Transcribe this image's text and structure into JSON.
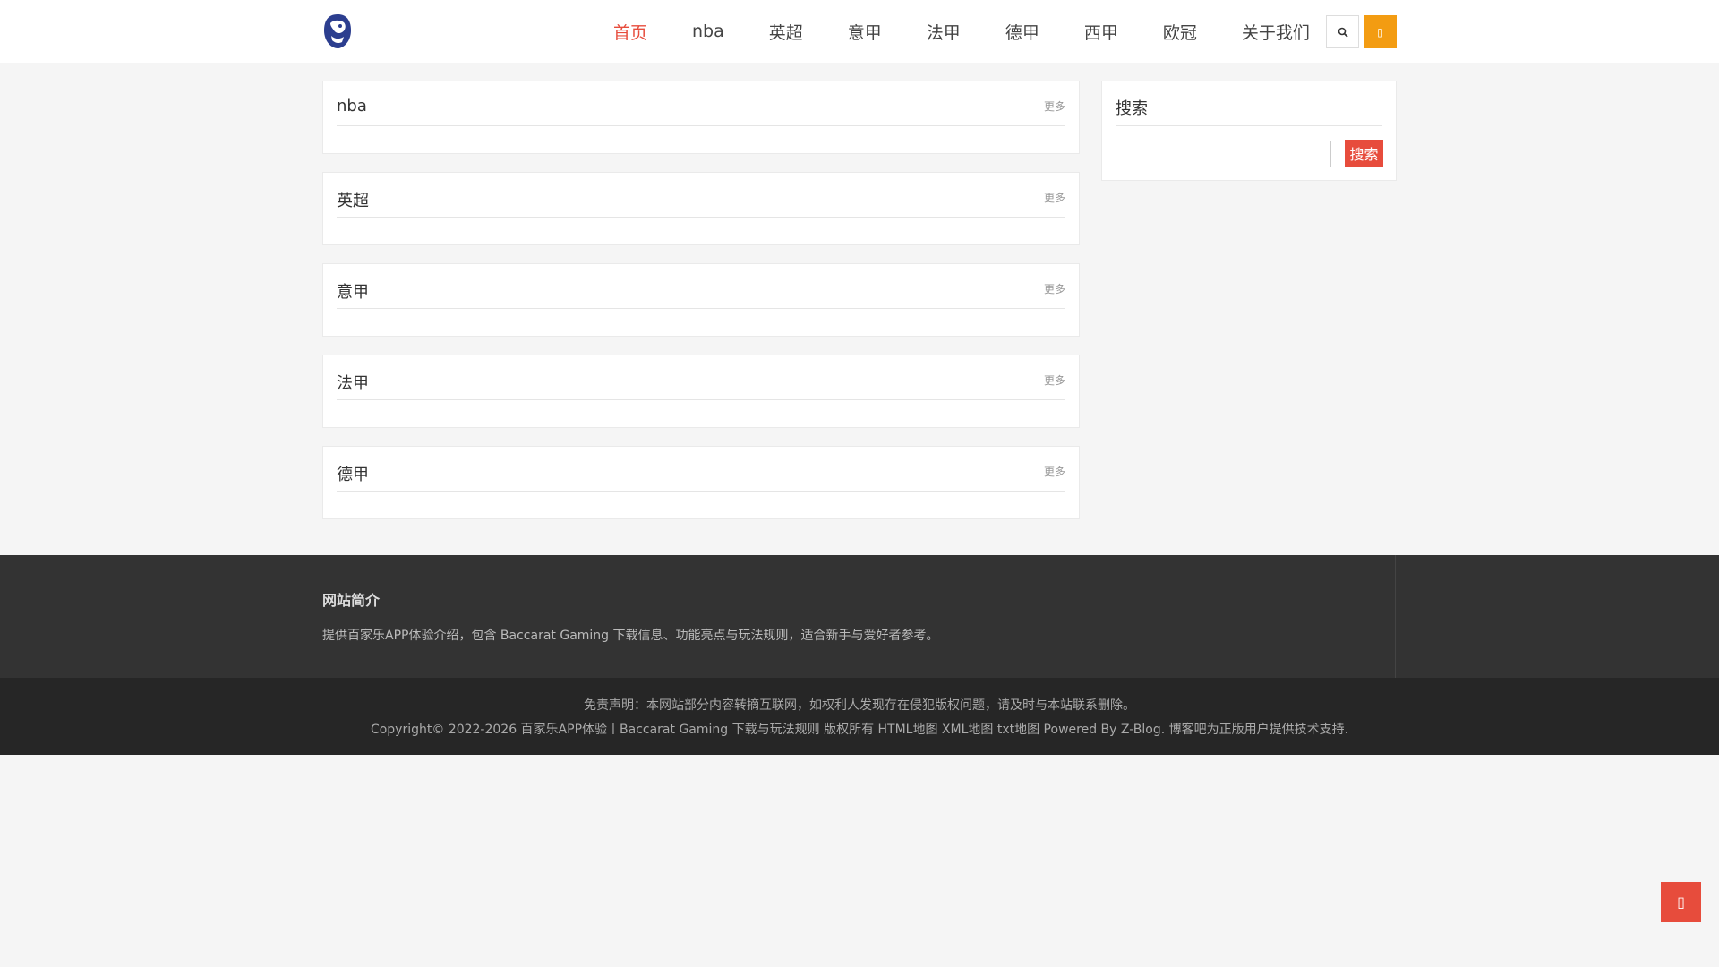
{
  "header": {
    "nav": [
      {
        "label": "首页",
        "active": true
      },
      {
        "label": "nba",
        "active": false
      },
      {
        "label": "英超",
        "active": false
      },
      {
        "label": "意甲",
        "active": false
      },
      {
        "label": "法甲",
        "active": false
      },
      {
        "label": "德甲",
        "active": false
      },
      {
        "label": "西甲",
        "active": false
      },
      {
        "label": "欧冠",
        "active": false
      },
      {
        "label": "关于我们",
        "active": false
      }
    ],
    "search_icon": "search-icon",
    "menu_icon": "menu-icon",
    "accent_color": "#e74c3c",
    "menu_button_color": "#f39c12"
  },
  "sections": [
    {
      "title": "nba",
      "more": "更多"
    },
    {
      "title": "英超",
      "more": "更多"
    },
    {
      "title": "意甲",
      "more": "更多"
    },
    {
      "title": "法甲",
      "more": "更多"
    },
    {
      "title": "德甲",
      "more": "更多"
    }
  ],
  "sidebar": {
    "title": "搜索",
    "input_value": "",
    "button_label": "搜索"
  },
  "footer": {
    "about_title": "网站简介",
    "about_text": "提供百家乐APP体验介绍，包含 Baccarat Gaming 下载信息、功能亮点与玩法规则，适合新手与爱好者参考。",
    "disclaimer": "免责声明：本网站部分内容转摘互联网，如权利人发现存在侵犯版权问题，请及时与本站联系删除。",
    "copyright": "Copyright© 2022-2026 百家乐APP体验丨Baccarat Gaming 下载与玩法规则 版权所有 HTML地图 XML地图 txt地图 Powered By Z-Blog. 博客吧为正版用户提供技术支持."
  },
  "back_to_top_icon": "arrow-up-icon"
}
